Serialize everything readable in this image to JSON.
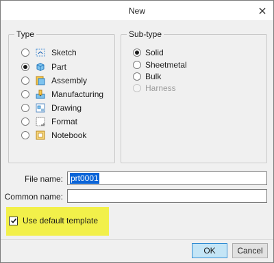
{
  "window": {
    "title": "New",
    "close_icon": "close-icon"
  },
  "type_group": {
    "legend": "Type",
    "options": [
      {
        "label": "Sketch",
        "selected": false,
        "icon": "sketch-icon"
      },
      {
        "label": "Part",
        "selected": true,
        "icon": "part-icon"
      },
      {
        "label": "Assembly",
        "selected": false,
        "icon": "assembly-icon"
      },
      {
        "label": "Manufacturing",
        "selected": false,
        "icon": "manufacturing-icon"
      },
      {
        "label": "Drawing",
        "selected": false,
        "icon": "drawing-icon"
      },
      {
        "label": "Format",
        "selected": false,
        "icon": "format-icon"
      },
      {
        "label": "Notebook",
        "selected": false,
        "icon": "notebook-icon"
      }
    ]
  },
  "subtype_group": {
    "legend": "Sub-type",
    "options": [
      {
        "label": "Solid",
        "selected": true,
        "enabled": true
      },
      {
        "label": "Sheetmetal",
        "selected": false,
        "enabled": true
      },
      {
        "label": "Bulk",
        "selected": false,
        "enabled": true
      },
      {
        "label": "Harness",
        "selected": false,
        "enabled": false
      }
    ]
  },
  "form": {
    "file_name_label": "File name:",
    "file_name_value": "prt0001",
    "common_name_label": "Common name:",
    "common_name_value": ""
  },
  "template": {
    "label": "Use default template",
    "checked": true,
    "highlight_color": "#f2f04a"
  },
  "buttons": {
    "ok": "OK",
    "cancel": "Cancel"
  },
  "colors": {
    "selection_blue": "#0a64d7",
    "primary_button": "#c4e5f6"
  }
}
